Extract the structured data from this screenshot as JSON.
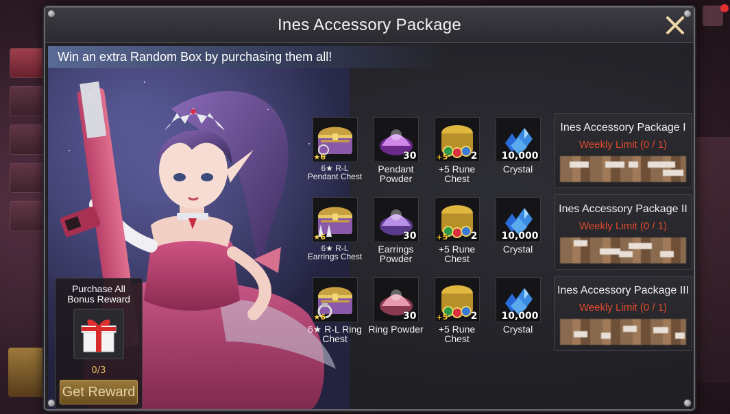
{
  "dialog": {
    "title": "Ines Accessory Package",
    "banner": "Win an extra Random Box by purchasing them all!",
    "close_icon": "close-icon"
  },
  "bonus": {
    "title_line1": "Purchase All",
    "title_line2": "Bonus Reward",
    "progress": "0/3",
    "button_label": "Get Reward",
    "icon": "gift-box-icon"
  },
  "items": [
    {
      "label_line1": "6★ R-L",
      "label_line2": "Pendant Chest",
      "badge": "6",
      "badge_type": "star",
      "qty": "",
      "icon": "pendant-chest-icon",
      "small": true
    },
    {
      "label_line1": "Pendant",
      "label_line2": "Powder",
      "badge": "",
      "badge_type": "",
      "qty": "30",
      "icon": "pendant-powder-icon",
      "small": false
    },
    {
      "label_line1": "+5 Rune",
      "label_line2": "Chest",
      "badge": "+5",
      "badge_type": "plus",
      "qty": "2",
      "icon": "rune-chest-icon",
      "small": false
    },
    {
      "label_line1": "Crystal",
      "label_line2": "",
      "badge": "",
      "badge_type": "",
      "qty": "10,000",
      "icon": "crystal-icon",
      "small": false
    },
    {
      "label_line1": "6★ R-L",
      "label_line2": "Earrings Chest",
      "badge": "6",
      "badge_type": "star",
      "qty": "",
      "icon": "earrings-chest-icon",
      "small": true
    },
    {
      "label_line1": "Earrings",
      "label_line2": "Powder",
      "badge": "",
      "badge_type": "",
      "qty": "30",
      "icon": "earrings-powder-icon",
      "small": false
    },
    {
      "label_line1": "+5 Rune",
      "label_line2": "Chest",
      "badge": "+5",
      "badge_type": "plus",
      "qty": "2",
      "icon": "rune-chest-icon",
      "small": false
    },
    {
      "label_line1": "Crystal",
      "label_line2": "",
      "badge": "",
      "badge_type": "",
      "qty": "10,000",
      "icon": "crystal-icon",
      "small": false
    },
    {
      "label_line1": "6★ R-L Ring",
      "label_line2": "Chest",
      "badge": "6",
      "badge_type": "star",
      "qty": "",
      "icon": "ring-chest-icon",
      "small": false
    },
    {
      "label_line1": "Ring Powder",
      "label_line2": "",
      "badge": "",
      "badge_type": "",
      "qty": "30",
      "icon": "ring-powder-icon",
      "small": false
    },
    {
      "label_line1": "+5 Rune",
      "label_line2": "Chest",
      "badge": "+5",
      "badge_type": "plus",
      "qty": "2",
      "icon": "rune-chest-icon",
      "small": false
    },
    {
      "label_line1": "Crystal",
      "label_line2": "",
      "badge": "",
      "badge_type": "",
      "qty": "10,000",
      "icon": "crystal-icon",
      "small": false
    }
  ],
  "packages": [
    {
      "name": "Ines Accessory Package I",
      "limit": "Weekly Limit (0 / 1)"
    },
    {
      "name": "Ines Accessory Package II",
      "limit": "Weekly Limit (0 / 1)"
    },
    {
      "name": "Ines Accessory Package III",
      "limit": "Weekly Limit (0 / 1)"
    }
  ],
  "colors": {
    "limit_red": "#e34a2a",
    "star_gold": "#ffd84a",
    "button_gold": "#9a7a3a",
    "crystal_blue": "#3a8ae0"
  }
}
